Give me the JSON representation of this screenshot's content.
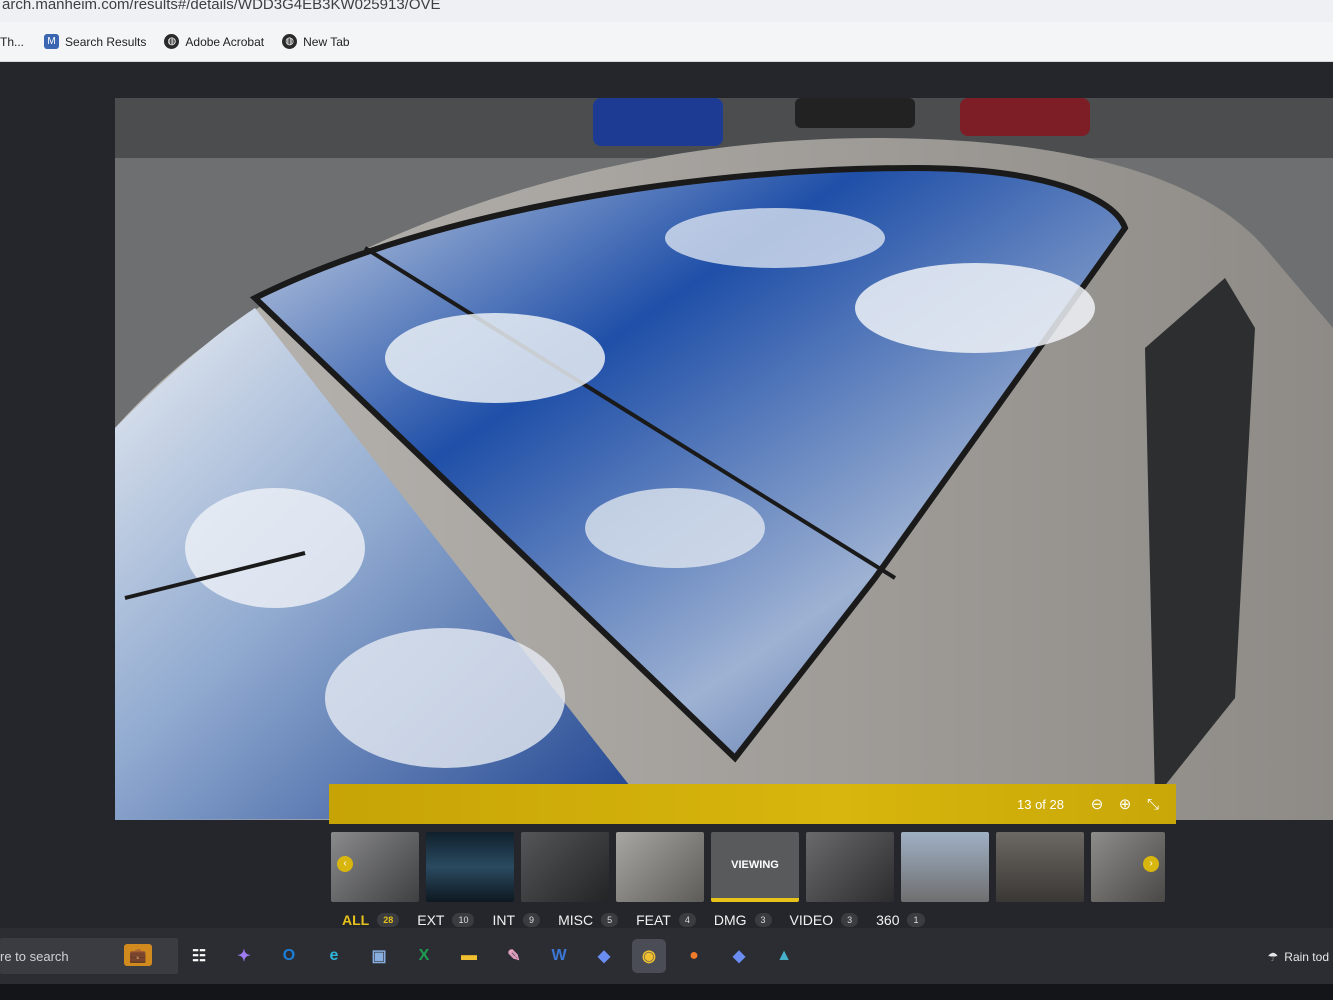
{
  "browser": {
    "address": "arch.manheim.com/results#/details/WDD3G4EB3KW025913/OVE",
    "bookmarks": [
      {
        "label": "Th...",
        "icon": "folder-icon"
      },
      {
        "label": "Search Results",
        "icon": "manheim-icon"
      },
      {
        "label": "Adobe Acrobat",
        "icon": "globe-icon"
      },
      {
        "label": "New Tab",
        "icon": "globe-icon"
      }
    ]
  },
  "viewer": {
    "counter": "13 of 28",
    "controls": [
      "zoom-out-icon",
      "zoom-in-icon",
      "collapse-icon"
    ],
    "accent_color": "#d8b60d",
    "thumbnails": [
      {
        "kind": "photo",
        "tone": "#6a6a6c"
      },
      {
        "kind": "photo",
        "tone": "#1d2a36"
      },
      {
        "kind": "photo",
        "tone": "#3a3b3d"
      },
      {
        "kind": "photo",
        "tone": "#8c8a86"
      },
      {
        "kind": "current",
        "label": "VIEWING"
      },
      {
        "kind": "photo",
        "tone": "#4a4a4c"
      },
      {
        "kind": "photo",
        "tone": "#7e8690"
      },
      {
        "kind": "photo",
        "tone": "#55524e"
      },
      {
        "kind": "photo",
        "tone": "#6c6b69"
      }
    ],
    "categories": [
      {
        "label": "ALL",
        "count": "28",
        "active": true
      },
      {
        "label": "EXT",
        "count": "10"
      },
      {
        "label": "INT",
        "count": "9"
      },
      {
        "label": "MISC",
        "count": "5"
      },
      {
        "label": "FEAT",
        "count": "4"
      },
      {
        "label": "DMG",
        "count": "3"
      },
      {
        "label": "VIDEO",
        "count": "3"
      },
      {
        "label": "360",
        "count": "1"
      }
    ]
  },
  "taskbar": {
    "search_text": "re to search",
    "apps": [
      "task-view-icon",
      "copilot-icon",
      "outlook-icon",
      "edge-icon",
      "remote-desktop-icon",
      "excel-icon",
      "file-explorer-icon",
      "paint-icon",
      "word-icon",
      "app-icon",
      "chrome-icon",
      "firefox-icon",
      "app-icon",
      "app-icon"
    ],
    "weather": "Rain tod"
  }
}
